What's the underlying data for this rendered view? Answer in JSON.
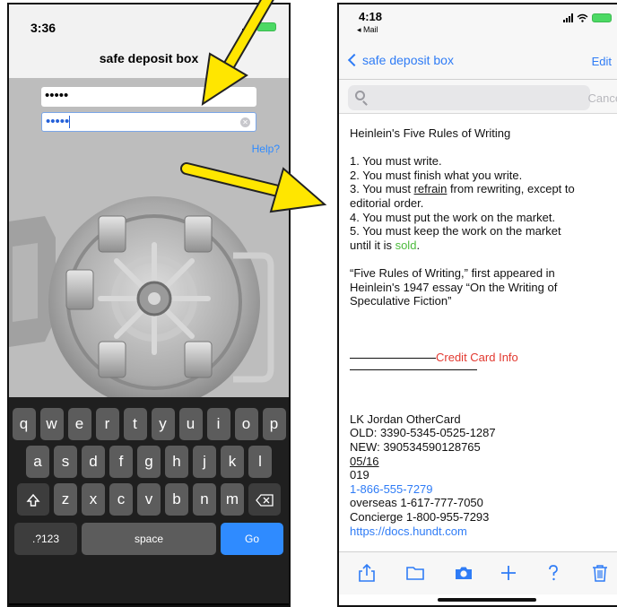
{
  "left_screen": {
    "time": "3:36",
    "nav_title": "safe deposit box",
    "field1_value": "•••••",
    "field2_value": "•••••",
    "help_link": "Help?",
    "keyboard": {
      "row1": [
        "q",
        "w",
        "e",
        "r",
        "t",
        "y",
        "u",
        "i",
        "o",
        "p"
      ],
      "row2": [
        "a",
        "s",
        "d",
        "f",
        "g",
        "h",
        "j",
        "k",
        "l"
      ],
      "row3": [
        "z",
        "x",
        "c",
        "v",
        "b",
        "n",
        "m"
      ],
      "numbers_key": ".?123",
      "space_key": "space",
      "go_key": "Go"
    }
  },
  "right_screen": {
    "time": "4:18",
    "back_app": "◂ Mail",
    "nav_back_label": "safe deposit box",
    "edit_label": "Edit",
    "search_cancel": "Cancel",
    "note": {
      "title": "Heinlein's Five Rules of Writing",
      "rule1": "1. You must write.",
      "rule2": "2. You must finish what you write.",
      "rule3_a": "3. You must ",
      "rule3_u": "refrain",
      "rule3_b": " from rewriting, except to",
      "rule3_c": "editorial order.",
      "rule4": "4. You must put the work on the market.",
      "rule5_a": "5. You must keep the work on the market",
      "rule5_b": "until it is ",
      "rule5_sold": "sold",
      "rule5_end": ".",
      "quote1": "“Five Rules of Writing,” first appeared in",
      "quote2": "Heinlein's 1947 essay “On the Writing of",
      "quote3": "Speculative Fiction”",
      "section_label": "Credit Card Info",
      "name_line": "LK Jordan  OtherCard",
      "old_line": "OLD: 3390-5345-0525-1287",
      "new_line": "NEW: 390534590128765",
      "exp_line": "05/16",
      "cvv_line": "019",
      "phone_link": "1-866-555-7279",
      "overseas_line": "overseas 1-617-777-7050",
      "concierge_line": "Concierge 1-800-955-7293",
      "url_partial": "https://docs.hundt.com"
    }
  },
  "colors": {
    "ios_blue": "#2f7cf6",
    "arrow_yellow": "#ffe600",
    "sold_green": "#4cbb3c",
    "credit_red": "#e2382f"
  }
}
